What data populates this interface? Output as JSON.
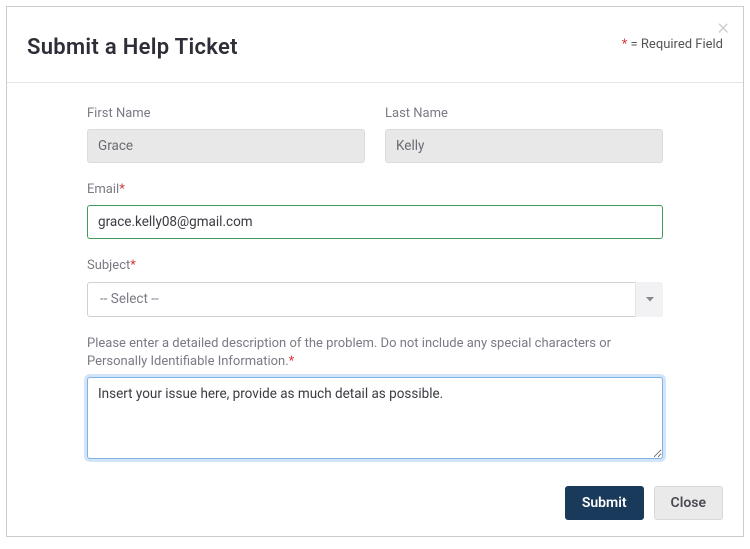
{
  "header": {
    "title": "Submit a Help Ticket",
    "required_hint_prefix": "*",
    "required_hint_text": " = Required Field"
  },
  "form": {
    "first_name": {
      "label": "First Name",
      "value": "Grace"
    },
    "last_name": {
      "label": "Last Name",
      "value": "Kelly"
    },
    "email": {
      "label": "Email",
      "value": "grace.kelly08@gmail.com"
    },
    "subject": {
      "label": "Subject",
      "selected": "-- Select --"
    },
    "description": {
      "label": "Please enter a detailed description of the problem. Do not include any special characters or Personally Identifiable Information.",
      "value": "Insert your issue here, provide as much detail as possible."
    }
  },
  "footer": {
    "submit": "Submit",
    "close": "Close"
  }
}
